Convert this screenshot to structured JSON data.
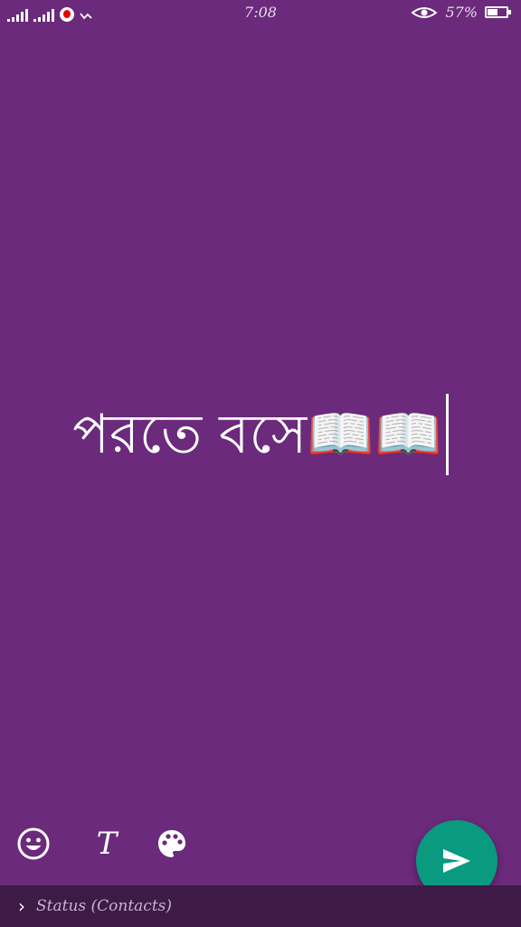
{
  "status_bar": {
    "time": "7:08",
    "battery": "57%",
    "battery_level": 0.57
  },
  "composer": {
    "text": "পরতে বসে📖📖"
  },
  "tools": {
    "text_tool": "T"
  },
  "footer": {
    "audience_label": "Status (Contacts)"
  },
  "colors": {
    "background": "#6b2a7b",
    "fab": "#0a9a80",
    "bottom_bar": "#3d1b46"
  },
  "icons": {
    "emoji": "emoji-icon",
    "palette": "palette-icon",
    "send": "send-icon",
    "chevron": "chevron-right-icon"
  }
}
